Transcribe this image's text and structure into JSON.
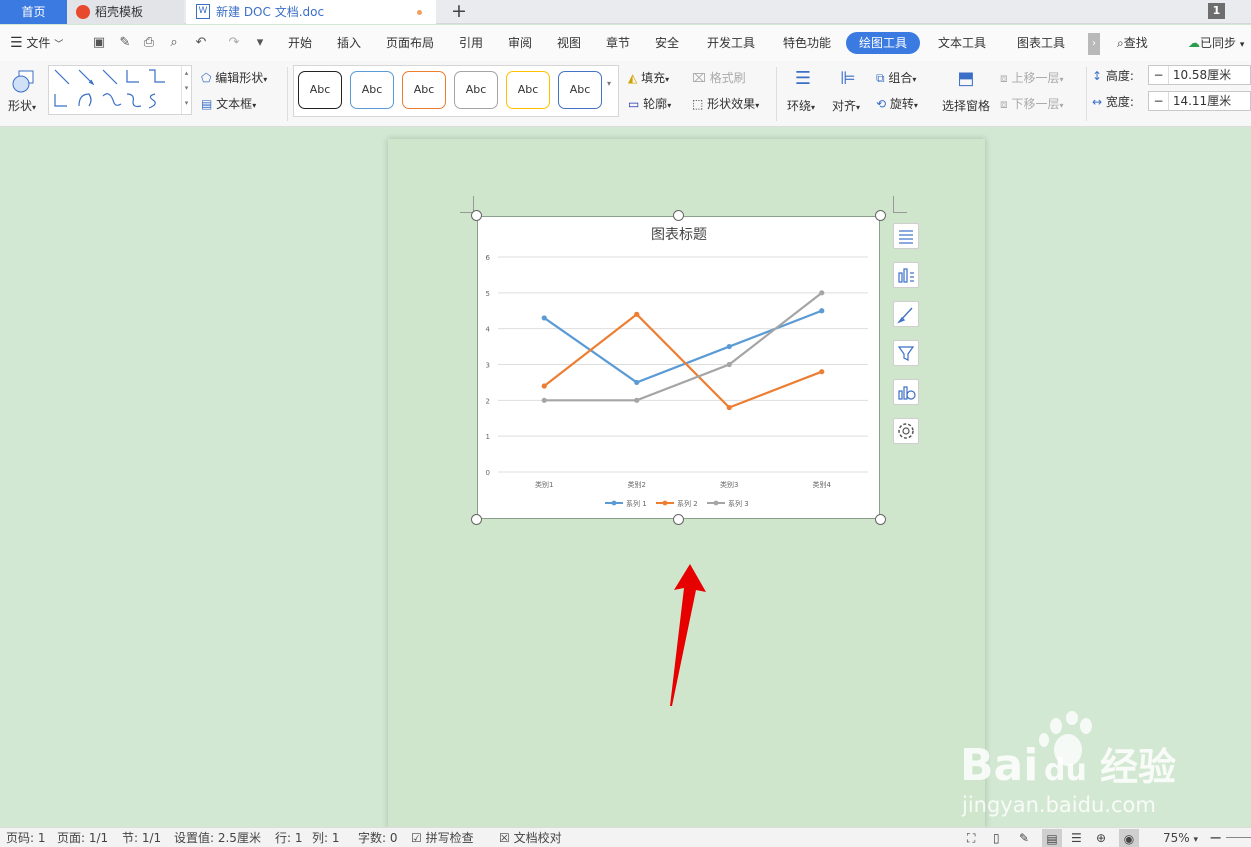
{
  "tabs": {
    "home": "首页",
    "template": "稻壳模板",
    "doc": "新建 DOC 文档.doc",
    "add": "+",
    "badge": "1"
  },
  "menu": {
    "file": "文件",
    "items": [
      "开始",
      "插入",
      "页面布局",
      "引用",
      "审阅",
      "视图",
      "章节",
      "安全",
      "开发工具",
      "特色功能",
      "绘图工具",
      "文本工具",
      "图表工具"
    ],
    "search": "查找",
    "sync": "已同步"
  },
  "ribbon": {
    "shape": "形状",
    "edit_shape": "编辑形状",
    "textbox": "文本框",
    "style_label": "Abc",
    "style_colors": [
      "#222222",
      "#5b9bd5",
      "#ed7d31",
      "#a5a5a5",
      "#ffc000",
      "#4472c4"
    ],
    "fill": "填充",
    "format_brush": "格式刷",
    "outline": "轮廓",
    "shape_effect": "形状效果",
    "wrap": "环绕",
    "align": "对齐",
    "group": "组合",
    "rotate": "旋转",
    "select_pane": "选择窗格",
    "bring_forward": "上移一层",
    "send_backward": "下移一层",
    "height_label": "高度:",
    "height_value": "10.58厘米",
    "width_label": "宽度:",
    "width_value": "14.11厘米"
  },
  "chart_data": {
    "type": "line",
    "title": "图表标题",
    "categories": [
      "类别1",
      "类别2",
      "类别3",
      "类别4"
    ],
    "series": [
      {
        "name": "系列 1",
        "color": "#5b9bd5",
        "values": [
          4.3,
          2.5,
          3.5,
          4.5
        ]
      },
      {
        "name": "系列 2",
        "color": "#ed7d31",
        "values": [
          2.4,
          4.4,
          1.8,
          2.8
        ]
      },
      {
        "name": "系列 3",
        "color": "#a5a5a5",
        "values": [
          2,
          2,
          3,
          5
        ]
      }
    ],
    "ylim": [
      0,
      6
    ],
    "yticks": [
      "0",
      "1",
      "2",
      "3",
      "4",
      "5",
      "6"
    ],
    "grid": true,
    "legend": "bottom"
  },
  "status": {
    "page_num": "页码: 1",
    "pages": "页面: 1/1",
    "section": "节: 1/1",
    "setting": "设置值: 2.5厘米",
    "row": "行: 1",
    "col": "列: 1",
    "words": "字数: 0",
    "spell": "拼写检查",
    "proof": "文档校对",
    "zoom": "75%"
  },
  "watermark": {
    "brand": "Bai",
    "brand2": "du",
    "brand3": "经验",
    "url": "jingyan.baidu.com"
  }
}
